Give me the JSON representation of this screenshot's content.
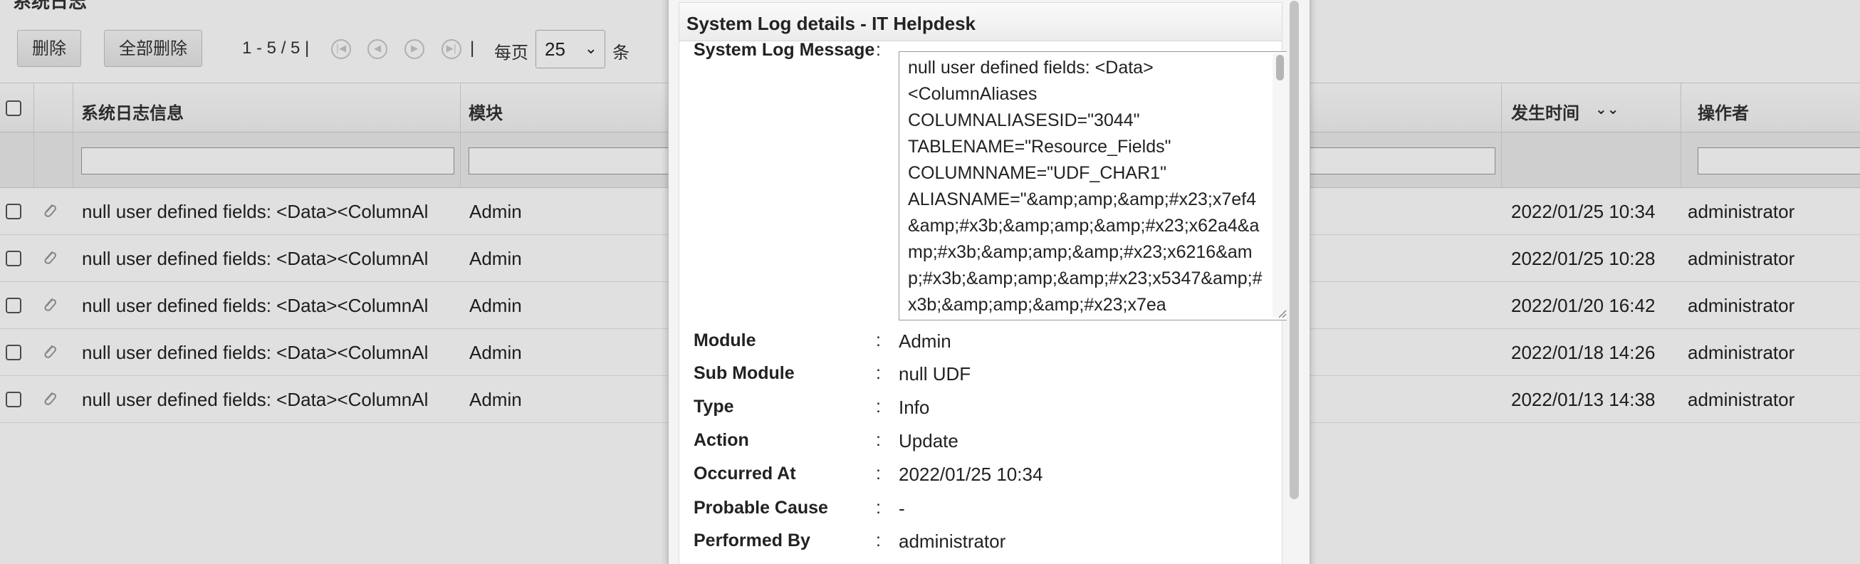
{
  "page": {
    "title": "系统日志"
  },
  "toolbar": {
    "delete_label": "删除",
    "delete_all_label": "全部删除",
    "range_text": "1 - 5 / 5 |",
    "separator": "|",
    "per_page_label": "每页",
    "per_page_value": "25",
    "per_page_unit": "条",
    "nav_icons": [
      "first-page-icon",
      "prev-page-icon",
      "next-page-icon",
      "last-page-icon"
    ]
  },
  "grid": {
    "columns": {
      "message": "系统日志信息",
      "module": "模块",
      "occurred_at": "发生时间",
      "sort_indicator": "⌄⌄",
      "performed_by": "操作者"
    },
    "rows": [
      {
        "message": "null user defined fields: <Data><ColumnAl",
        "module": "Admin",
        "occurred_at": "2022/01/25 10:34",
        "performed_by": "administrator"
      },
      {
        "message": "null user defined fields: <Data><ColumnAl",
        "module": "Admin",
        "occurred_at": "2022/01/25 10:28",
        "performed_by": "administrator"
      },
      {
        "message": "null user defined fields: <Data><ColumnAl",
        "module": "Admin",
        "occurred_at": "2022/01/20 16:42",
        "performed_by": "administrator"
      },
      {
        "message": "null user defined fields: <Data><ColumnAl",
        "module": "Admin",
        "occurred_at": "2022/01/18 14:26",
        "performed_by": "administrator"
      },
      {
        "message": "null user defined fields: <Data><ColumnAl",
        "module": "Admin",
        "occurred_at": "2022/01/13 14:38",
        "performed_by": "administrator"
      }
    ]
  },
  "modal": {
    "title": "System Log details - IT Helpdesk",
    "colon": ":",
    "labels": {
      "message": "System Log Message",
      "module": "Module",
      "sub_module": "Sub Module",
      "type": "Type",
      "action": "Action",
      "occurred_at": "Occurred At",
      "probable_cause": "Probable Cause",
      "performed_by": "Performed By"
    },
    "values": {
      "message": "null user defined fields: <Data>\n<ColumnAliases\nCOLUMNALIASESID=\"3044\"\nTABLENAME=\"Resource_Fields\"\nCOLUMNNAME=\"UDF_CHAR1\"\nALIASNAME=\"&amp;amp;&amp;#x23;x7ef4&amp;#x3b;&amp;amp;&amp;#x23;x62a4&amp;#x3b;&amp;amp;&amp;#x23;x6216&amp;#x3b;&amp;amp;&amp;#x23;x5347&amp;#x3b;&amp;amp;&amp;#x23;x7ea",
      "module": "Admin",
      "sub_module": "null UDF",
      "type": "Info",
      "action": "Update",
      "occurred_at": "2022/01/25 10:34",
      "probable_cause": "-",
      "performed_by": "administrator"
    }
  }
}
